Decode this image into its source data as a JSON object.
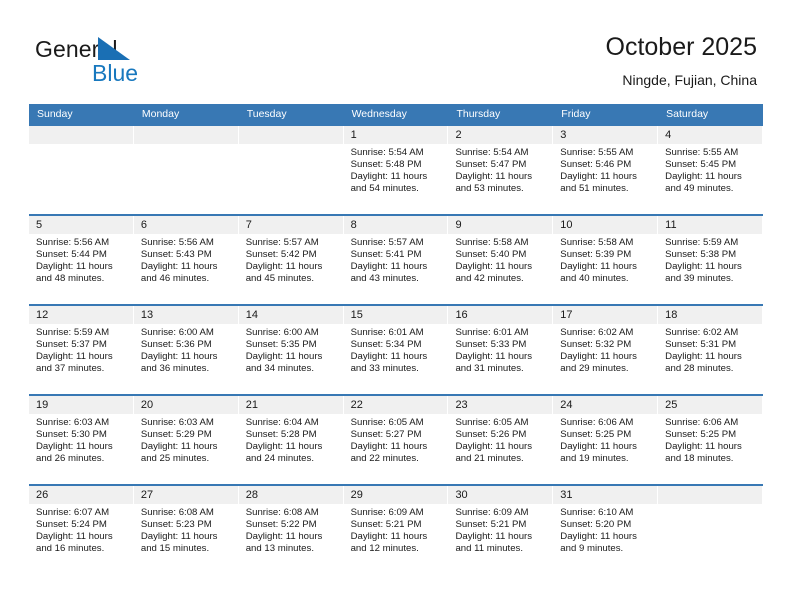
{
  "brand": {
    "name_part1": "General",
    "name_part2": "Blue",
    "flag_icon": "blue-triangle-flag-icon",
    "accent_color": "#1878be"
  },
  "header": {
    "month_title": "October 2025",
    "location": "Ningde, Fujian, China"
  },
  "colors": {
    "header_blue": "#3878b4",
    "day_number_bg": "#f0f0f0",
    "text": "#1a1a1a"
  },
  "calendar": {
    "weekday_headers": [
      "Sunday",
      "Monday",
      "Tuesday",
      "Wednesday",
      "Thursday",
      "Friday",
      "Saturday"
    ],
    "weeks": [
      [
        {
          "day": "",
          "lines": []
        },
        {
          "day": "",
          "lines": []
        },
        {
          "day": "",
          "lines": []
        },
        {
          "day": "1",
          "lines": [
            "Sunrise: 5:54 AM",
            "Sunset: 5:48 PM",
            "Daylight: 11 hours and 54 minutes."
          ]
        },
        {
          "day": "2",
          "lines": [
            "Sunrise: 5:54 AM",
            "Sunset: 5:47 PM",
            "Daylight: 11 hours and 53 minutes."
          ]
        },
        {
          "day": "3",
          "lines": [
            "Sunrise: 5:55 AM",
            "Sunset: 5:46 PM",
            "Daylight: 11 hours and 51 minutes."
          ]
        },
        {
          "day": "4",
          "lines": [
            "Sunrise: 5:55 AM",
            "Sunset: 5:45 PM",
            "Daylight: 11 hours and 49 minutes."
          ]
        }
      ],
      [
        {
          "day": "5",
          "lines": [
            "Sunrise: 5:56 AM",
            "Sunset: 5:44 PM",
            "Daylight: 11 hours and 48 minutes."
          ]
        },
        {
          "day": "6",
          "lines": [
            "Sunrise: 5:56 AM",
            "Sunset: 5:43 PM",
            "Daylight: 11 hours and 46 minutes."
          ]
        },
        {
          "day": "7",
          "lines": [
            "Sunrise: 5:57 AM",
            "Sunset: 5:42 PM",
            "Daylight: 11 hours and 45 minutes."
          ]
        },
        {
          "day": "8",
          "lines": [
            "Sunrise: 5:57 AM",
            "Sunset: 5:41 PM",
            "Daylight: 11 hours and 43 minutes."
          ]
        },
        {
          "day": "9",
          "lines": [
            "Sunrise: 5:58 AM",
            "Sunset: 5:40 PM",
            "Daylight: 11 hours and 42 minutes."
          ]
        },
        {
          "day": "10",
          "lines": [
            "Sunrise: 5:58 AM",
            "Sunset: 5:39 PM",
            "Daylight: 11 hours and 40 minutes."
          ]
        },
        {
          "day": "11",
          "lines": [
            "Sunrise: 5:59 AM",
            "Sunset: 5:38 PM",
            "Daylight: 11 hours and 39 minutes."
          ]
        }
      ],
      [
        {
          "day": "12",
          "lines": [
            "Sunrise: 5:59 AM",
            "Sunset: 5:37 PM",
            "Daylight: 11 hours and 37 minutes."
          ]
        },
        {
          "day": "13",
          "lines": [
            "Sunrise: 6:00 AM",
            "Sunset: 5:36 PM",
            "Daylight: 11 hours and 36 minutes."
          ]
        },
        {
          "day": "14",
          "lines": [
            "Sunrise: 6:00 AM",
            "Sunset: 5:35 PM",
            "Daylight: 11 hours and 34 minutes."
          ]
        },
        {
          "day": "15",
          "lines": [
            "Sunrise: 6:01 AM",
            "Sunset: 5:34 PM",
            "Daylight: 11 hours and 33 minutes."
          ]
        },
        {
          "day": "16",
          "lines": [
            "Sunrise: 6:01 AM",
            "Sunset: 5:33 PM",
            "Daylight: 11 hours and 31 minutes."
          ]
        },
        {
          "day": "17",
          "lines": [
            "Sunrise: 6:02 AM",
            "Sunset: 5:32 PM",
            "Daylight: 11 hours and 29 minutes."
          ]
        },
        {
          "day": "18",
          "lines": [
            "Sunrise: 6:02 AM",
            "Sunset: 5:31 PM",
            "Daylight: 11 hours and 28 minutes."
          ]
        }
      ],
      [
        {
          "day": "19",
          "lines": [
            "Sunrise: 6:03 AM",
            "Sunset: 5:30 PM",
            "Daylight: 11 hours and 26 minutes."
          ]
        },
        {
          "day": "20",
          "lines": [
            "Sunrise: 6:03 AM",
            "Sunset: 5:29 PM",
            "Daylight: 11 hours and 25 minutes."
          ]
        },
        {
          "day": "21",
          "lines": [
            "Sunrise: 6:04 AM",
            "Sunset: 5:28 PM",
            "Daylight: 11 hours and 24 minutes."
          ]
        },
        {
          "day": "22",
          "lines": [
            "Sunrise: 6:05 AM",
            "Sunset: 5:27 PM",
            "Daylight: 11 hours and 22 minutes."
          ]
        },
        {
          "day": "23",
          "lines": [
            "Sunrise: 6:05 AM",
            "Sunset: 5:26 PM",
            "Daylight: 11 hours and 21 minutes."
          ]
        },
        {
          "day": "24",
          "lines": [
            "Sunrise: 6:06 AM",
            "Sunset: 5:25 PM",
            "Daylight: 11 hours and 19 minutes."
          ]
        },
        {
          "day": "25",
          "lines": [
            "Sunrise: 6:06 AM",
            "Sunset: 5:25 PM",
            "Daylight: 11 hours and 18 minutes."
          ]
        }
      ],
      [
        {
          "day": "26",
          "lines": [
            "Sunrise: 6:07 AM",
            "Sunset: 5:24 PM",
            "Daylight: 11 hours and 16 minutes."
          ]
        },
        {
          "day": "27",
          "lines": [
            "Sunrise: 6:08 AM",
            "Sunset: 5:23 PM",
            "Daylight: 11 hours and 15 minutes."
          ]
        },
        {
          "day": "28",
          "lines": [
            "Sunrise: 6:08 AM",
            "Sunset: 5:22 PM",
            "Daylight: 11 hours and 13 minutes."
          ]
        },
        {
          "day": "29",
          "lines": [
            "Sunrise: 6:09 AM",
            "Sunset: 5:21 PM",
            "Daylight: 11 hours and 12 minutes."
          ]
        },
        {
          "day": "30",
          "lines": [
            "Sunrise: 6:09 AM",
            "Sunset: 5:21 PM",
            "Daylight: 11 hours and 11 minutes."
          ]
        },
        {
          "day": "31",
          "lines": [
            "Sunrise: 6:10 AM",
            "Sunset: 5:20 PM",
            "Daylight: 11 hours and 9 minutes."
          ]
        },
        {
          "day": "",
          "lines": []
        }
      ]
    ]
  }
}
